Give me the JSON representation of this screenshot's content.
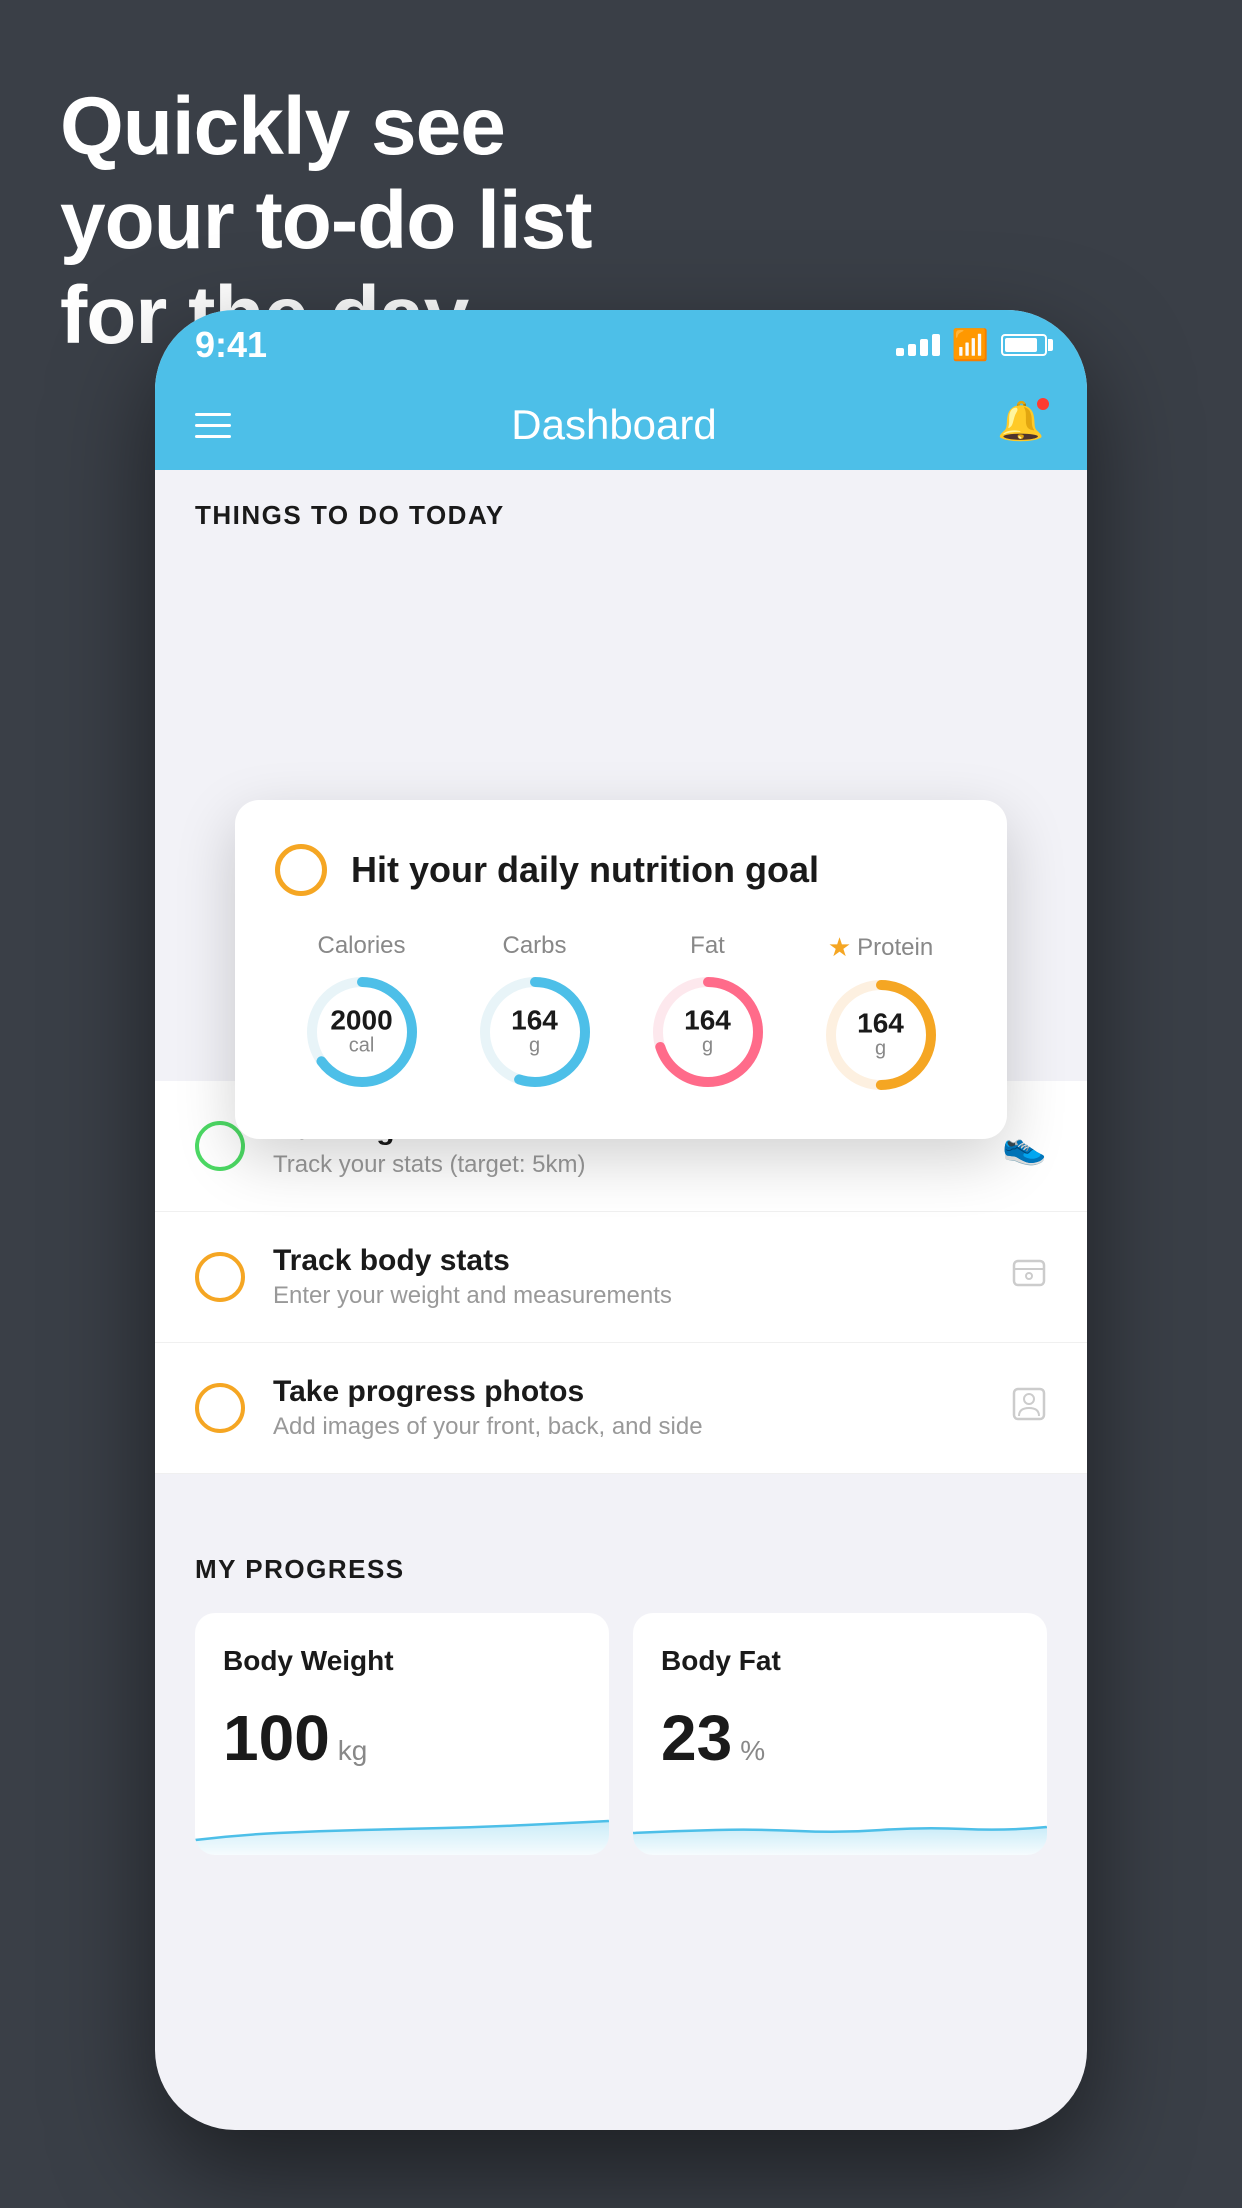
{
  "background": {
    "color": "#3a3f47"
  },
  "headline": {
    "line1": "Quickly see",
    "line2": "your to-do list",
    "line3": "for the day."
  },
  "phone": {
    "status_bar": {
      "time": "9:41",
      "signal_label": "signal",
      "wifi_label": "wifi",
      "battery_label": "battery"
    },
    "nav_bar": {
      "title": "Dashboard",
      "menu_label": "menu",
      "bell_label": "notifications"
    },
    "things_to_do": {
      "section_title": "THINGS TO DO TODAY"
    },
    "nutrition_card": {
      "title": "Hit your daily nutrition goal",
      "macros": [
        {
          "label": "Calories",
          "value": "2000",
          "unit": "cal",
          "color": "#4dbfe8",
          "starred": false,
          "percent": 65
        },
        {
          "label": "Carbs",
          "value": "164",
          "unit": "g",
          "color": "#4dbfe8",
          "starred": false,
          "percent": 55
        },
        {
          "label": "Fat",
          "value": "164",
          "unit": "g",
          "color": "#ff6b8a",
          "starred": false,
          "percent": 70
        },
        {
          "label": "Protein",
          "value": "164",
          "unit": "g",
          "color": "#f5a623",
          "starred": true,
          "percent": 50
        }
      ]
    },
    "todo_items": [
      {
        "title": "Running",
        "subtitle": "Track your stats (target: 5km)",
        "circle_color": "green",
        "icon": "shoe"
      },
      {
        "title": "Track body stats",
        "subtitle": "Enter your weight and measurements",
        "circle_color": "yellow",
        "icon": "scale"
      },
      {
        "title": "Take progress photos",
        "subtitle": "Add images of your front, back, and side",
        "circle_color": "yellow",
        "icon": "person"
      }
    ],
    "progress": {
      "section_title": "MY PROGRESS",
      "cards": [
        {
          "title": "Body Weight",
          "value": "100",
          "unit": "kg"
        },
        {
          "title": "Body Fat",
          "value": "23",
          "unit": "%"
        }
      ]
    }
  }
}
